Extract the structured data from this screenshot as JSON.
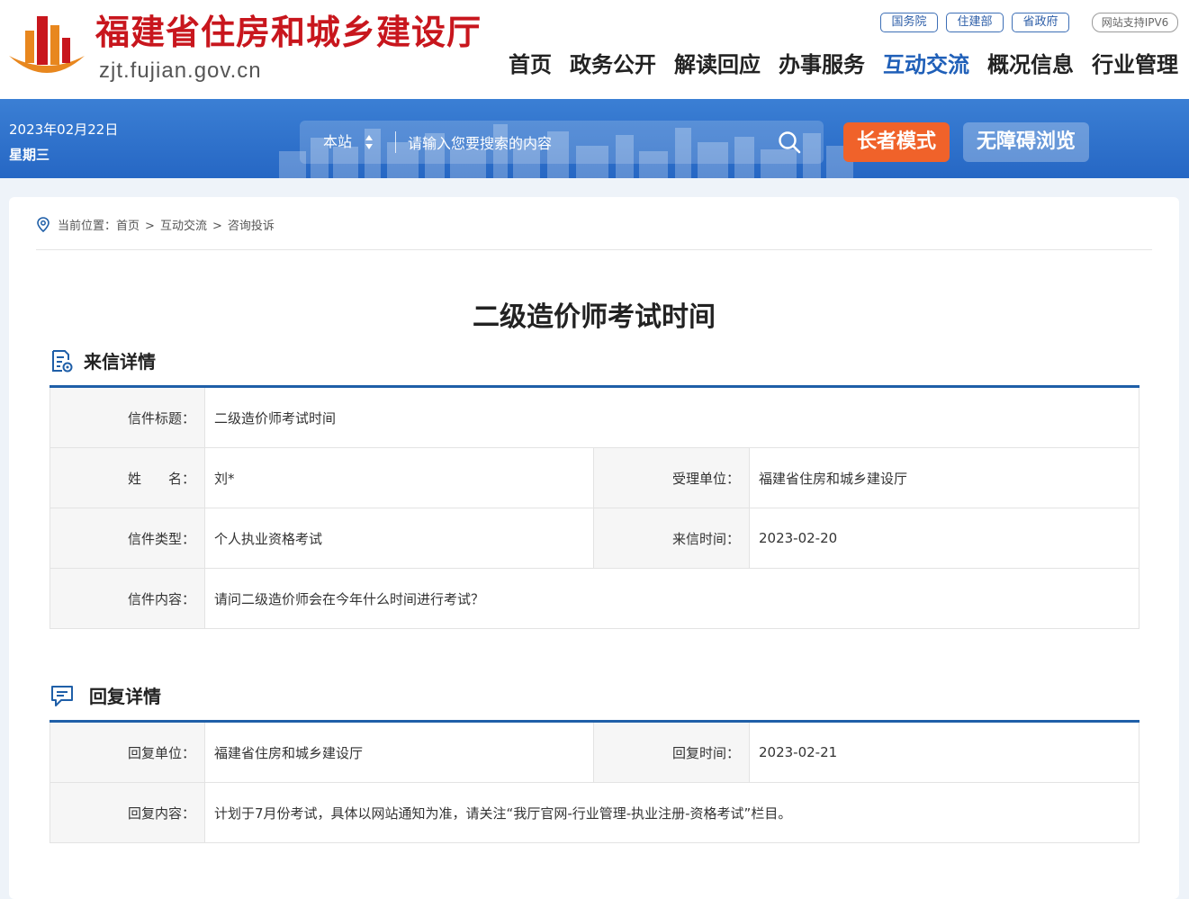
{
  "header": {
    "site_title": "福建省住房和城乡建设厅",
    "site_domain": "zjt.fujian.gov.cn",
    "top_links": [
      "国务院",
      "住建部",
      "省政府"
    ],
    "ipv6": "网站支持IPV6",
    "nav": [
      "首页",
      "政务公开",
      "解读回应",
      "办事服务",
      "互动交流",
      "概况信息",
      "行业管理"
    ],
    "nav_active": "互动交流",
    "brand_color": "#c8161d",
    "accent_color": "#1f5fb8"
  },
  "banner": {
    "date": "2023年02月22日",
    "weekday": "星期三",
    "search_scope": "本站",
    "search_placeholder": "请输入您要搜索的内容",
    "elder_mode": "长者模式",
    "accessible": "无障碍浏览",
    "elder_color": "#f0622a"
  },
  "breadcrumb": {
    "prefix": "当前位置：",
    "items": [
      "首页",
      "互动交流",
      "咨询投诉"
    ],
    "sep": ">"
  },
  "page_title": "二级造价师考试时间",
  "letter": {
    "heading": "来信详情",
    "subject_label": "信件标题：",
    "subject": "二级造价师考试时间",
    "name_label": "姓　　名：",
    "name": "刘*",
    "unit_label": "受理单位：",
    "unit": "福建省住房和城乡建设厅",
    "type_label": "信件类型：",
    "type": "个人执业资格考试",
    "time_label": "来信时间：",
    "time": "2023-02-20",
    "content_label": "信件内容：",
    "content": "请问二级造价师会在今年什么时间进行考试？"
  },
  "reply": {
    "heading": "回复详情",
    "unit_label": "回复单位：",
    "unit": "福建省住房和城乡建设厅",
    "time_label": "回复时间：",
    "time": "2023-02-21",
    "content_label": "回复内容：",
    "content": "计划于7月份考试，具体以网站通知为准，请关注“我厅官网-行业管理-执业注册-资格考试”栏目。"
  }
}
